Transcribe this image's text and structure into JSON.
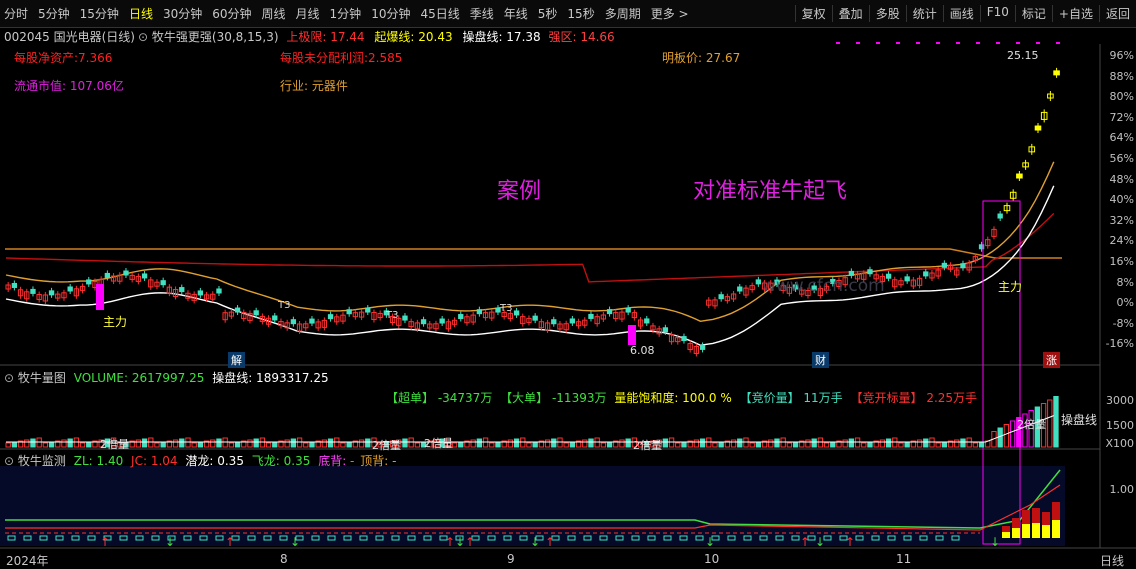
{
  "toolbar": {
    "tabs": [
      "分时",
      "5分钟",
      "15分钟",
      "日线",
      "30分钟",
      "60分钟",
      "周线",
      "月线",
      "1分钟",
      "10分钟",
      "45日线",
      "季线",
      "年线",
      "5秒",
      "15秒",
      "多周期",
      "更多 >"
    ],
    "active": "日线",
    "tools": [
      "复权",
      "叠加",
      "多股",
      "统计",
      "画线",
      "F10",
      "标记",
      "+自选",
      "返回"
    ]
  },
  "header": {
    "stock": "002045 国光电器(日线)",
    "indicator_name": "牧牛强更强(30,8,15,3)",
    "upper_limit": "上极限: 17.44",
    "burst_line": "起爆线: 20.43",
    "control_line": "操盘线: 17.38",
    "strong_zone": "强区: 14.66"
  },
  "info": {
    "net_asset": "每股净资产:7.366",
    "undistributed": "每股未分配利润:2.585",
    "limit_price": "明板价:  27.67",
    "float_cap": "流通市值:  107.06亿",
    "industry": "行业: 元器件"
  },
  "annotations": {
    "case": "案例",
    "slogan": "对准标准牛起飞",
    "price_high": "25.15",
    "price_low": "6.08",
    "zhuli": "主力",
    "watermark": "www.cfcn.com",
    "marker_jie": "解",
    "marker_cai": "财",
    "marker_zhang": "涨",
    "vol_double": "2倍量",
    "vol_control": "操盘线",
    "t3": "T3"
  },
  "price_axis": [
    "96%",
    "88%",
    "80%",
    "72%",
    "64%",
    "56%",
    "48%",
    "40%",
    "32%",
    "24%",
    "16%",
    "8%",
    "0%",
    "-8%",
    "-16%"
  ],
  "volume_pane": {
    "title": "牧牛量图",
    "volume": "VOLUME: 2617997.25",
    "control": "操盘线: 1893317.25",
    "super_order": "【超单】  -34737万",
    "big_order": "【大单】  -11393万",
    "saturation": "量能饱和度:  100.0 %",
    "bid_vol": "【竞价量】  11万手",
    "open_vol": "【竞开标量】  2.25万手",
    "axis": [
      "3000",
      "1500",
      "X100"
    ]
  },
  "monitor_pane": {
    "title": "牧牛监测",
    "zl": "ZL: 1.40",
    "jc": "JC: 1.04",
    "qianlong": "潜龙: 0.35",
    "feilong": "飞龙: 0.35",
    "dibei": "底背: -",
    "dingbei": "顶背: -",
    "axis": [
      "1.00"
    ]
  },
  "x_axis": {
    "labels": [
      "2024年",
      "8",
      "9",
      "10",
      "11"
    ],
    "unit": "日线"
  },
  "colors": {
    "up": "#ff3030",
    "down": "#40e0c0",
    "ma_orange": "#e0a030",
    "ma_red": "#c01010",
    "ma_white": "#ffffff",
    "hline": "#d08020",
    "magenta": "#ff00ff",
    "yellow": "#ffff00"
  }
}
